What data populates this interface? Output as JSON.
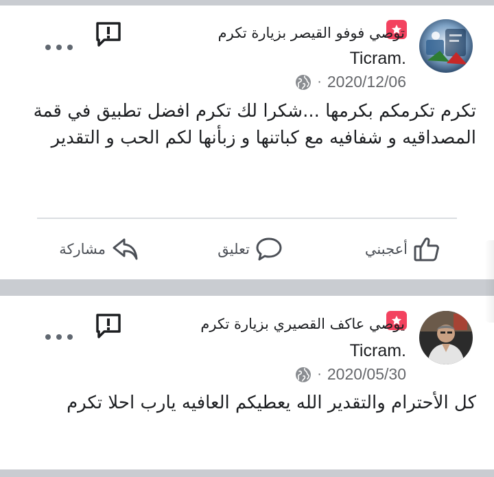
{
  "posts": [
    {
      "recommender": "توصي فوفو القيصر بزيارة تكرم",
      "business": "Ticram.",
      "date": "2020/12/06",
      "separator": "·",
      "body": "تكرم تكرمكم بكرمها ...شكرا لك تكرم افضل تطبيق في قمة المصداقيه و شفافيه مع كباتنها و زبأنها لكم الحب و التقدير",
      "actions": {
        "like_label": "أعجبني",
        "comment_label": "تعليق",
        "share_label": "مشاركة"
      }
    },
    {
      "recommender": "يوصي عاكف القصيري بزيارة تكرم",
      "business": "Ticram.",
      "date": "2020/05/30",
      "separator": "·",
      "body": "كل الأحترام والتقدير الله يعطيكم العافيه يارب احلا تكرم"
    }
  ],
  "colors": {
    "recommendation_badge": "#f3425f",
    "background_band": "#c9ccd1",
    "text_primary": "#1c1e21",
    "text_secondary": "#65676b"
  },
  "icons": [
    "recommendation-star-icon",
    "globe-icon",
    "report-icon",
    "more-options-icon",
    "like-icon",
    "comment-icon",
    "share-icon"
  ]
}
